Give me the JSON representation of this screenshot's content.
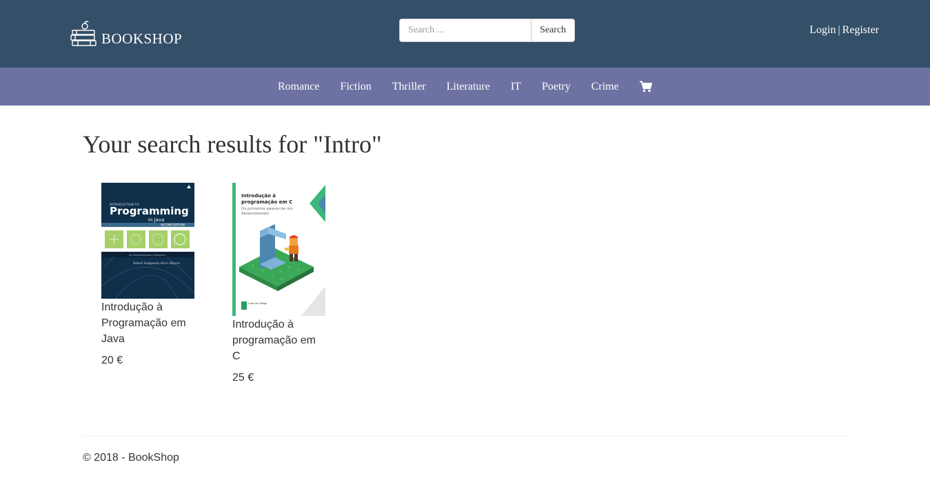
{
  "header": {
    "logo_text": "BOOKSHOP",
    "search": {
      "placeholder": "Search ...",
      "value": "",
      "button_label": "Search"
    },
    "auth": {
      "login": "Login",
      "separator": "|",
      "register": "Register"
    },
    "colors": {
      "header_bg": "#344f68",
      "nav_bg": "#6d72a2"
    }
  },
  "nav": {
    "categories": [
      "Romance",
      "Fiction",
      "Thriller",
      "Literature",
      "IT",
      "Poetry",
      "Crime"
    ],
    "cart_icon": "shopping-cart-icon"
  },
  "main": {
    "title": "Your search results for \"Intro\"",
    "products": [
      {
        "name": "Introdução à Programação em Java",
        "price": "20 €",
        "cover_text": {
          "kicker": "INTRODUCTION TO",
          "title": "Programming",
          "subtitle": "in Java",
          "edition": "SECOND EDITION",
          "tagline": "An Interdisciplinary Approach",
          "authors": "Robert Sedgewick   Kevin Wayne"
        }
      },
      {
        "name": "Introdução à programação em C",
        "price": "25 €",
        "cover_text": {
          "title1": "Introdução à",
          "title2": "programação em C",
          "subtitle1": "Os primeiros passos de um",
          "subtitle2": "desenvolvedor",
          "publisher": "Casa do Código"
        }
      }
    ]
  },
  "footer": {
    "text": "© 2018 - BookShop"
  }
}
